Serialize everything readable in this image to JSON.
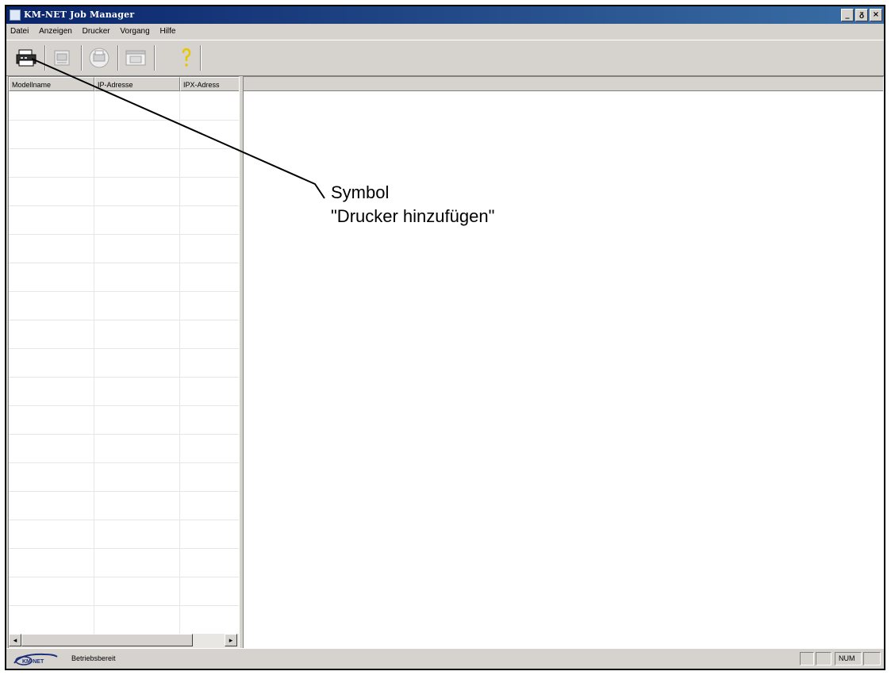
{
  "window": {
    "title": "KM-NET Job Manager",
    "controls": [
      "_",
      "ᵹ",
      "×"
    ]
  },
  "menubar": {
    "items": [
      "Datei",
      "Anzeigen",
      "Drucker",
      "Vorgang",
      "Hilfe"
    ]
  },
  "toolbar": {
    "buttons": [
      {
        "icon": "add-printer-icon",
        "active": true
      },
      {
        "icon": "printer-properties-icon",
        "active": false
      },
      {
        "icon": "printer-group-icon",
        "active": false
      },
      {
        "icon": "job-window-icon",
        "active": false
      },
      {
        "icon": "help-question-icon",
        "active": true
      }
    ]
  },
  "printer_list": {
    "columns": [
      "Modellname",
      "IP-Adresse",
      "IPX-Adress"
    ],
    "rows": []
  },
  "scrollbar": {
    "left_arrow": "◂",
    "right_arrow": "▸"
  },
  "status_bar": {
    "logo": "KM-NET",
    "text": "Betriebsbereit",
    "num": "NUM"
  },
  "annotation": {
    "line1": "Symbol",
    "line2": "\"Drucker hinzufügen\""
  }
}
